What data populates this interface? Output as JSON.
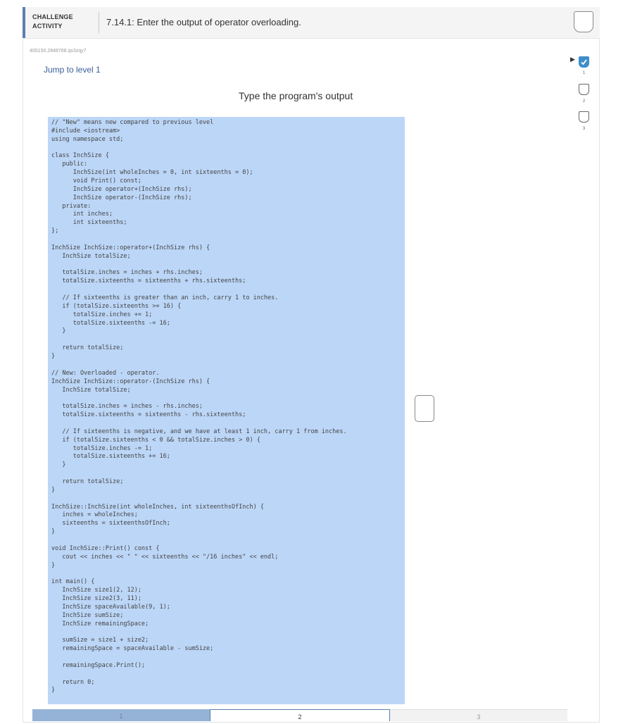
{
  "header": {
    "badge_line1": "CHALLENGE",
    "badge_line2": "ACTIVITY",
    "title": "7.14.1: Enter the output of operator overloading."
  },
  "reference_id": "405150.2848768.qx3zqy7",
  "jump_link": "Jump to level 1",
  "prompt": "Type the program's output",
  "levels": [
    {
      "label": "1",
      "completed": true
    },
    {
      "label": "2",
      "completed": false
    },
    {
      "label": "3",
      "completed": false
    }
  ],
  "code_lines": [
    "// \"New\" means new compared to previous level",
    "#include <iostream>",
    "using namespace std;",
    "",
    "class InchSize {",
    "   public:",
    "      InchSize(int wholeInches = 0, int sixteenths = 0);",
    "      void Print() const;",
    "      InchSize operator+(InchSize rhs);",
    "      InchSize operator-(InchSize rhs);",
    "   private:",
    "      int inches;",
    "      int sixteenths;",
    "};",
    "",
    "InchSize InchSize::operator+(InchSize rhs) {",
    "   InchSize totalSize;",
    "",
    "   totalSize.inches = inches + rhs.inches;",
    "   totalSize.sixteenths = sixteenths + rhs.sixteenths;",
    "",
    "   // If sixteenths is greater than an inch, carry 1 to inches.",
    "   if (totalSize.sixteenths >= 16) {",
    "      totalSize.inches += 1;",
    "      totalSize.sixteenths -= 16;",
    "   }",
    "",
    "   return totalSize;",
    "}",
    "",
    "// New: Overloaded - operator.",
    "InchSize InchSize::operator-(InchSize rhs) {",
    "   InchSize totalSize;",
    "",
    "   totalSize.inches = inches - rhs.inches;",
    "   totalSize.sixteenths = sixteenths - rhs.sixteenths;",
    "",
    "   // If sixteenths is negative, and we have at least 1 inch, carry 1 from inches.",
    "   if (totalSize.sixteenths < 0 && totalSize.inches > 0) {",
    "      totalSize.inches -= 1;",
    "      totalSize.sixteenths += 16;",
    "   }",
    "",
    "   return totalSize;",
    "}",
    "",
    "InchSize::InchSize(int wholeInches, int sixteenthsOfInch) {",
    "   inches = wholeInches;",
    "   sixteenths = sixteenthsOfInch;",
    "}",
    "",
    "void InchSize::Print() const {",
    "   cout << inches << \" \" << sixteenths << \"/16 inches\" << endl;",
    "}",
    "",
    "int main() {",
    "   InchSize size1(2, 12);",
    "   InchSize size2(3, 11);",
    "   InchSize spaceAvailable(9, 1);",
    "   InchSize sumSize;",
    "   InchSize remainingSpace;",
    "",
    "   sumSize = size1 + size2;",
    "   remainingSpace = spaceAvailable - sumSize;",
    "",
    "   remainingSpace.Print();",
    "",
    "   return 0;",
    "}"
  ],
  "tabs": [
    {
      "label": "1"
    },
    {
      "label": "2"
    },
    {
      "label": "3"
    }
  ]
}
